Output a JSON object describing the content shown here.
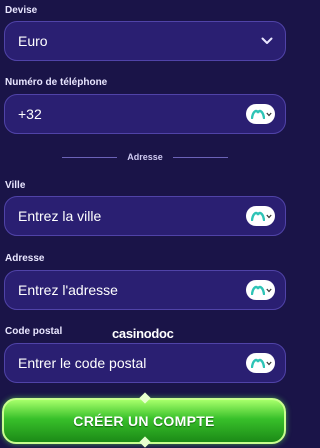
{
  "currency": {
    "label": "Devise",
    "value": "Euro"
  },
  "phone": {
    "label": "Numéro de téléphone",
    "value": "+32"
  },
  "address_section": {
    "title": "Adresse"
  },
  "city": {
    "label": "Ville",
    "placeholder": "Entrez la ville"
  },
  "address": {
    "label": "Adresse",
    "placeholder": "Entrez l'adresse"
  },
  "postal_code": {
    "label": "Code postal",
    "placeholder": "Entrer le code postal"
  },
  "watermark": {
    "text": "casinodoc"
  },
  "submit": {
    "label": "CRÉER UN COMPTE"
  },
  "colors": {
    "background": "#1a1448",
    "field_bg": "#2a1f72",
    "field_border": "#5043a8",
    "badge_logo": "#2ec4b6",
    "cta_green": "#38c02a"
  },
  "icons": {
    "select_arrow": "chevron-down-icon",
    "autofill_badge": "autofill-badge-icon"
  }
}
